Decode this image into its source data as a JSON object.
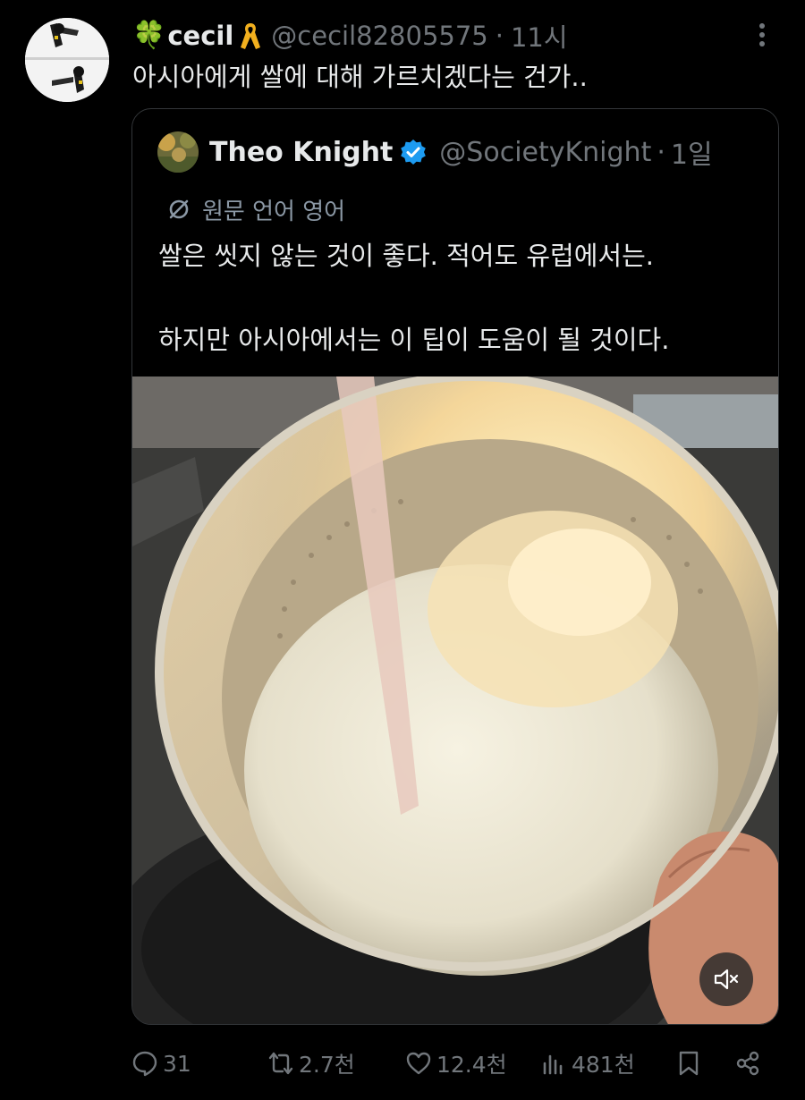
{
  "tweet": {
    "clover": "🍀",
    "display_name": "cecil",
    "handle": "@cecil82805575",
    "separator": "·",
    "time": "11시",
    "text": "아시아에게 쌀에 대해 가르치겠다는 건가.."
  },
  "quote": {
    "display_name": "Theo Knight",
    "handle": "@SocietyKnight",
    "separator": "·",
    "time": "1일",
    "translation_label": "원문 언어 영어",
    "text_line1": "쌀은 씻지 않는 것이 좋다. 적어도 유럽에서는.",
    "text_line2": "하지만 아시아에서는 이 팁이 도움이 될 것이다."
  },
  "actions": {
    "replies": "31",
    "retweets": "2.7천",
    "likes": "12.4천",
    "views": "481천"
  },
  "icons": {
    "more": "more-icon",
    "ribbon": "yellow-ribbon-icon",
    "verified": "verified-badge-icon",
    "translate": "translate-icon",
    "mute": "mute-icon",
    "reply": "reply-icon",
    "retweet": "retweet-icon",
    "like": "heart-icon",
    "views": "views-icon",
    "bookmark": "bookmark-icon",
    "share": "share-icon"
  },
  "colors": {
    "background": "#000000",
    "text": "#e7e9ea",
    "secondary_text": "#71767b",
    "verified_blue": "#1d9bf0",
    "ribbon_yellow": "#f2b01e"
  }
}
